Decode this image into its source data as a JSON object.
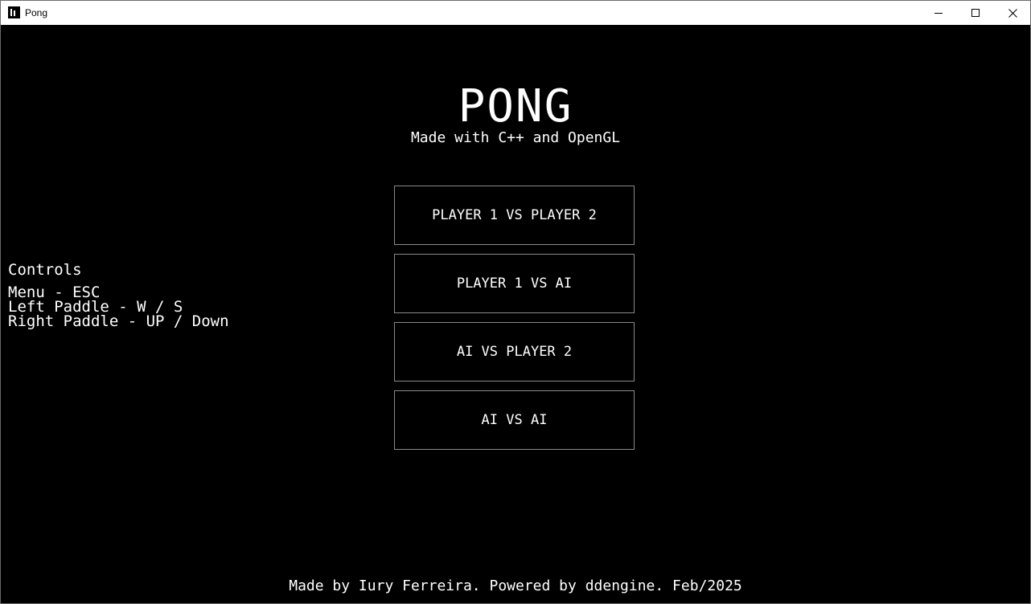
{
  "window": {
    "title": "Pong",
    "icon": "pong-app-icon",
    "controls": {
      "minimize_icon": "minimize-icon",
      "maximize_icon": "maximize-icon",
      "close_icon": "close-icon"
    }
  },
  "game": {
    "title": "PONG",
    "subtitle": "Made with C++ and OpenGL",
    "menu": [
      {
        "label": "PLAYER 1 VS PLAYER 2"
      },
      {
        "label": "PLAYER 1 VS AI"
      },
      {
        "label": "AI VS PLAYER 2"
      },
      {
        "label": "AI VS AI"
      }
    ],
    "controls": {
      "heading": "Controls",
      "lines": [
        "Menu - ESC",
        "Left Paddle - W / S",
        "Right Paddle - UP / Down"
      ]
    },
    "footer": "Made by Iury Ferreira. Powered by ddengine. Feb/2025"
  },
  "colors": {
    "background": "#000000",
    "foreground": "#ffffff",
    "button_border": "#8a8a8a",
    "titlebar": "#ffffff"
  }
}
